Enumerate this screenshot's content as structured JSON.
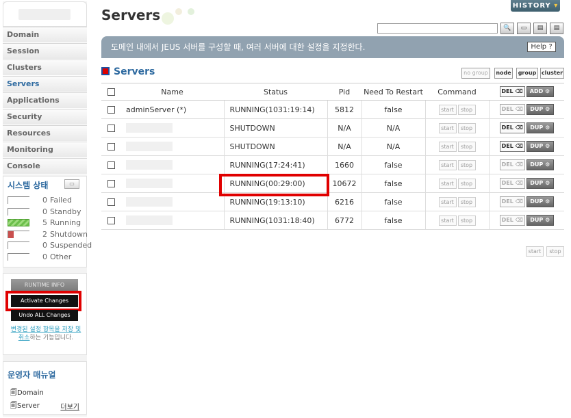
{
  "sidebar": {
    "menu": [
      {
        "label": "Domain"
      },
      {
        "label": "Session"
      },
      {
        "label": "Clusters"
      },
      {
        "label": "Servers"
      },
      {
        "label": "Applications"
      },
      {
        "label": "Security"
      },
      {
        "label": "Resources"
      },
      {
        "label": "Monitoring"
      },
      {
        "label": "Console"
      }
    ],
    "system_status": {
      "title": "시스템 상태",
      "rows": [
        {
          "count": "0",
          "label": "Failed"
        },
        {
          "count": "0",
          "label": "Standby"
        },
        {
          "count": "5",
          "label": "Running"
        },
        {
          "count": "2",
          "label": "Shutdown"
        },
        {
          "count": "0",
          "label": "Suspended"
        },
        {
          "count": "0",
          "label": "Other"
        }
      ]
    },
    "actions": {
      "runtime_info": "RUNTIME INFO",
      "activate": "Activate Changes",
      "undo": "Undo ALL Changes",
      "note_link": "변경된 설정 항목을 저장 및 취소",
      "note_rest": "하는 기능입니다."
    },
    "manual": {
      "title": "운영자 매뉴얼",
      "links": [
        {
          "label": "Domain"
        },
        {
          "label": "Server"
        }
      ],
      "more": "더보기"
    }
  },
  "header": {
    "title": "Servers",
    "history": "HISTORY",
    "search_placeholder": "",
    "description": "도메인 내에서 JEUS 서버를 구성할 때, 여러 서버에 대한 설정을 지정한다.",
    "help": "Help"
  },
  "section": {
    "title": "Servers",
    "views": [
      "no group",
      "node",
      "group",
      "cluster"
    ]
  },
  "table": {
    "columns": [
      "Name",
      "Status",
      "Pid",
      "Need To Restart",
      "Command"
    ],
    "del_label": "DEL",
    "add_label": "ADD",
    "dup_label": "DUP",
    "start_label": "start",
    "stop_label": "stop",
    "rows": [
      {
        "name": "adminServer (*)",
        "status": "RUNNING(1031:19:14)",
        "pid": "5812",
        "restart": "false"
      },
      {
        "name": "",
        "status": "SHUTDOWN",
        "pid": "N/A",
        "restart": "N/A"
      },
      {
        "name": "",
        "status": "SHUTDOWN",
        "pid": "N/A",
        "restart": "N/A"
      },
      {
        "name": "",
        "status": "RUNNING(17:24:41)",
        "pid": "1660",
        "restart": "false"
      },
      {
        "name": "",
        "status": "RUNNING(00:29:00)",
        "pid": "10672",
        "restart": "false"
      },
      {
        "name": "",
        "status": "RUNNING(19:13:10)",
        "pid": "6216",
        "restart": "false"
      },
      {
        "name": "",
        "status": "RUNNING(1031:18:40)",
        "pid": "6772",
        "restart": "false"
      }
    ]
  }
}
